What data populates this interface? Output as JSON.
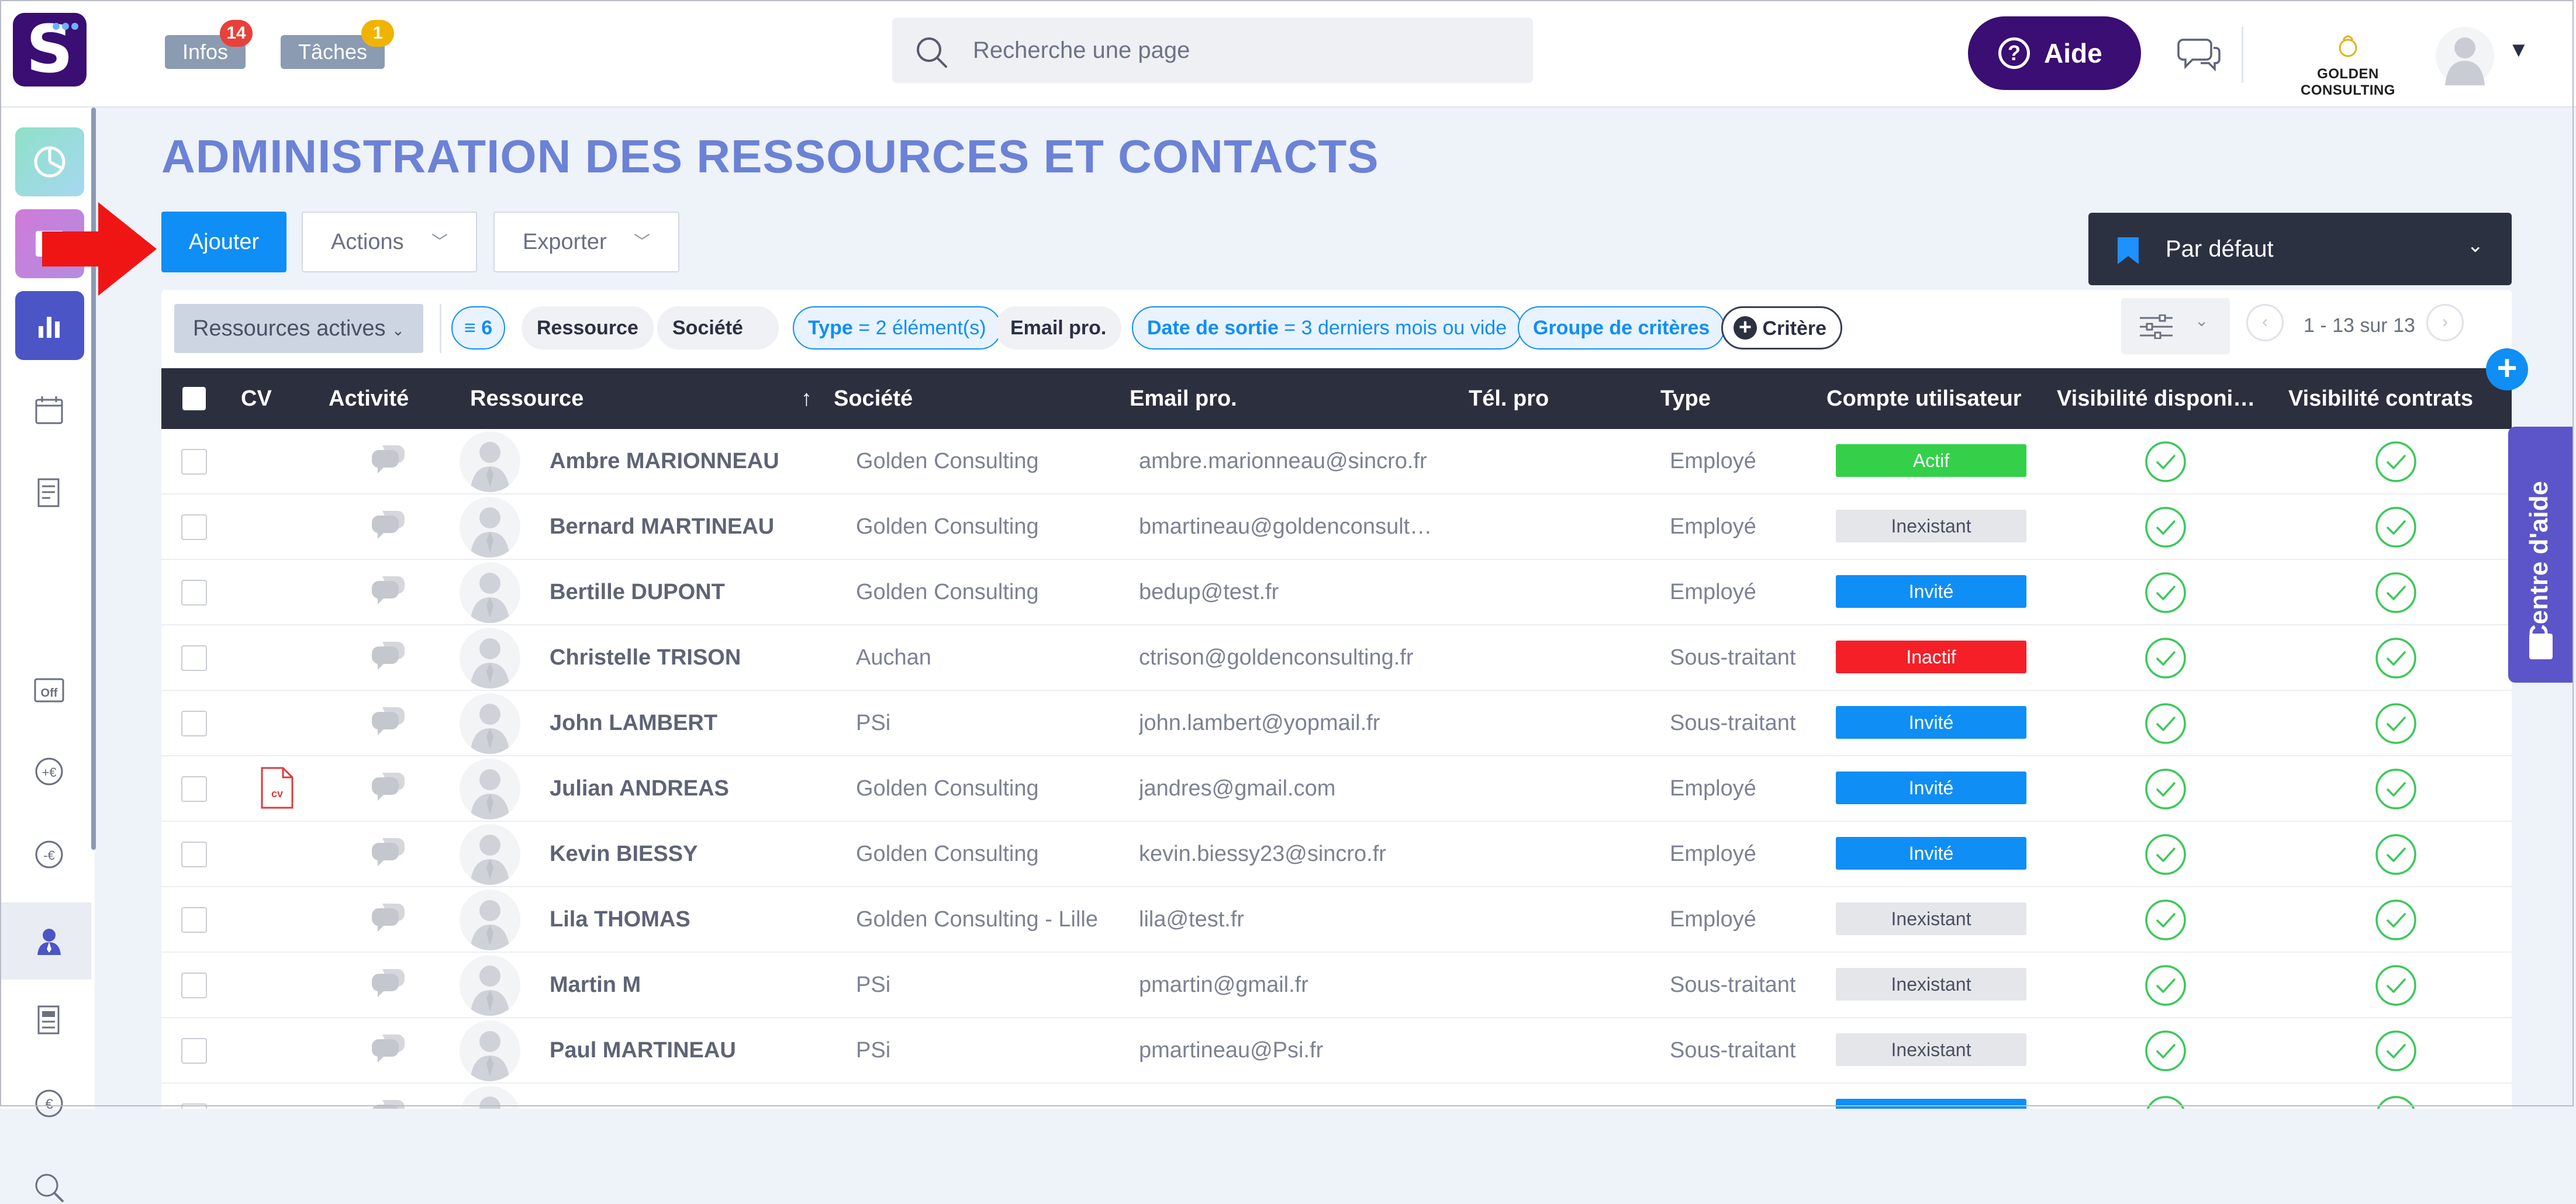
{
  "topbar": {
    "infos": {
      "label": "Infos",
      "badge": "14",
      "badge_color": "#e8413a"
    },
    "taches": {
      "label": "Tâches",
      "badge": "1",
      "badge_color": "#f0b400"
    },
    "search_placeholder": "Recherche une page",
    "aide_label": "Aide",
    "company": "GOLDEN CONSULTING"
  },
  "page": {
    "title": "ADMINISTRATION DES RESSOURCES ET CONTACTS",
    "add_label": "Ajouter",
    "actions_label": "Actions",
    "export_label": "Exporter",
    "view_label": "Par défaut"
  },
  "filters": {
    "active_selector": "Ressources actives",
    "count": "6",
    "chip_ressource": "Ressource",
    "chip_societe": "Société",
    "type_name": "Type",
    "type_value": " = 2 élément(s)",
    "chip_email": "Email pro.",
    "date_name": "Date de sortie",
    "date_value": " = 3 derniers mois ou vide",
    "groupe": "Groupe de critères",
    "critere": "Critère",
    "pagination": "1 - 13 sur 13"
  },
  "table": {
    "columns": {
      "cv": "CV",
      "activite": "Activité",
      "ressource": "Ressource",
      "sort_indicator": "↑",
      "societe": "Société",
      "email": "Email pro.",
      "tel": "Tél. pro",
      "type": "Type",
      "compte": "Compte utilisateur",
      "vis_dispo": "Visibilité disponi…",
      "vis_contrats": "Visibilité contrats"
    },
    "rows": [
      {
        "name": "Ambre MARIONNEAU",
        "company": "Golden Consulting",
        "email": "ambre.marionneau@sincro.fr",
        "type": "Employé",
        "status": "Actif",
        "cv": false
      },
      {
        "name": "Bernard MARTINEAU",
        "company": "Golden Consulting",
        "email": "bmartineau@goldenconsult…",
        "type": "Employé",
        "status": "Inexistant",
        "cv": false
      },
      {
        "name": "Bertille DUPONT",
        "company": "Golden Consulting",
        "email": "bedup@test.fr",
        "type": "Employé",
        "status": "Invité",
        "cv": false
      },
      {
        "name": "Christelle TRISON",
        "company": "Auchan",
        "email": "ctrison@goldenconsulting.fr",
        "type": "Sous-traitant",
        "status": "Inactif",
        "cv": false
      },
      {
        "name": "John LAMBERT",
        "company": "PSi",
        "email": "john.lambert@yopmail.fr",
        "type": "Sous-traitant",
        "status": "Invité",
        "cv": false
      },
      {
        "name": "Julian ANDREAS",
        "company": "Golden Consulting",
        "email": "jandres@gmail.com",
        "type": "Employé",
        "status": "Invité",
        "cv": true
      },
      {
        "name": "Kevin BIESSY",
        "company": "Golden Consulting",
        "email": "kevin.biessy23@sincro.fr",
        "type": "Employé",
        "status": "Invité",
        "cv": false
      },
      {
        "name": "Lila THOMAS",
        "company": "Golden Consulting - Lille",
        "email": "lila@test.fr",
        "type": "Employé",
        "status": "Inexistant",
        "cv": false
      },
      {
        "name": "Martin M",
        "company": "PSi",
        "email": "pmartin@gmail.fr",
        "type": "Sous-traitant",
        "status": "Inexistant",
        "cv": false
      },
      {
        "name": "Paul MARTINEAU",
        "company": "PSi",
        "email": "pmartineau@Psi.fr",
        "type": "Sous-traitant",
        "status": "Inexistant",
        "cv": false
      }
    ]
  },
  "help_tab": "Centre d'aide",
  "colors": {
    "primary": "#0f8ef5",
    "brand": "#3a0e73",
    "title": "#6b82d6",
    "header": "#2c2f3e"
  }
}
